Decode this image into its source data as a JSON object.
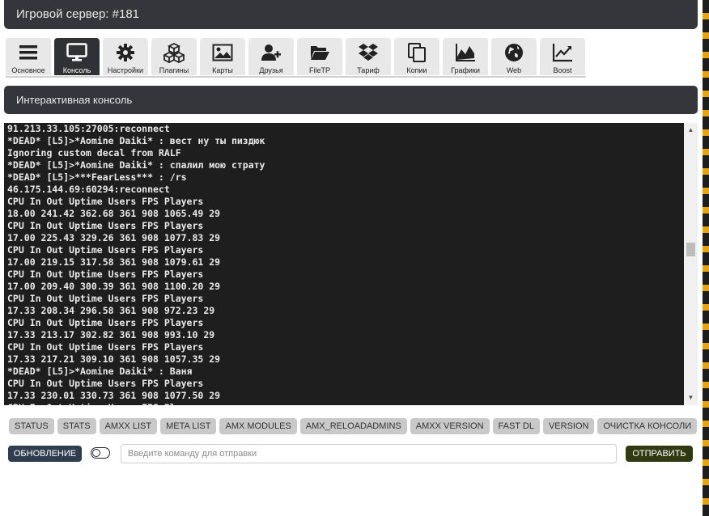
{
  "header": {
    "title": "Игровой сервер: #181"
  },
  "tabs": [
    {
      "label": "Основное",
      "icon": "menu-icon"
    },
    {
      "label": "Консоль",
      "icon": "monitor-icon",
      "active": true
    },
    {
      "label": "Настройки",
      "icon": "gear-icon"
    },
    {
      "label": "Плагины",
      "icon": "cubes-icon"
    },
    {
      "label": "Карты",
      "icon": "image-icon"
    },
    {
      "label": "Друзья",
      "icon": "add-user-icon"
    },
    {
      "label": "FileTP",
      "icon": "folder-open-icon"
    },
    {
      "label": "Тариф",
      "icon": "dropbox-icon"
    },
    {
      "label": "Копии",
      "icon": "copy-icon"
    },
    {
      "label": "Графики",
      "icon": "area-chart-icon"
    },
    {
      "label": "Web",
      "icon": "globe-icon"
    },
    {
      "label": "Boost",
      "icon": "line-chart-icon"
    }
  ],
  "console_section": {
    "title": "Интерактивная консоль"
  },
  "console": {
    "lines": [
      "91.213.33.105:27005:reconnect",
      "*DEAD* [L5]>*Aomine Daiki* : вест ну ты пиздюк",
      "Ignoring custom decal from RALF",
      "*DEAD* [L5]>*Aomine Daiki* : спалил мою страту",
      "*DEAD* [L5]>***FearLess*** : /rs",
      "46.175.144.69:60294:reconnect",
      "CPU In Out Uptime Users FPS Players",
      "18.00 241.42 362.68 361 908 1065.49 29",
      "CPU In Out Uptime Users FPS Players",
      "17.00 225.43 329.26 361 908 1077.83 29",
      "CPU In Out Uptime Users FPS Players",
      "17.00 219.15 317.58 361 908 1079.61 29",
      "CPU In Out Uptime Users FPS Players",
      "17.00 209.40 300.39 361 908 1100.20 29",
      "CPU In Out Uptime Users FPS Players",
      "17.33 208.34 296.58 361 908 972.23 29",
      "CPU In Out Uptime Users FPS Players",
      "17.33 213.17 302.82 361 908 993.10 29",
      "CPU In Out Uptime Users FPS Players",
      "17.33 217.21 309.10 361 908 1057.35 29",
      "*DEAD* [L5]>*Aomine Daiki* : Ваня",
      "CPU In Out Uptime Users FPS Players",
      "17.33 230.01 330.73 361 908 1077.50 29",
      "CPU In Out Uptime Users FPS Players"
    ]
  },
  "commands": [
    "STATUS",
    "STATS",
    "AMXX LIST",
    "META LIST",
    "AMX MODULES",
    "AMX_RELOADADMINS",
    "AMXX VERSION",
    "FAST DL",
    "VERSION",
    "ОЧИСТКА КОНСОЛИ"
  ],
  "controls": {
    "refresh_label": "ОБНОВЛЕНИЕ",
    "input_placeholder": "Введите команду для отправки",
    "input_value": "",
    "send_label": "ОТПРАВИТЬ"
  },
  "colors": {
    "header_bg": "#35363b",
    "active_tab_bg": "#2f3136",
    "console_bg": "#1e1e1e",
    "refresh_bg": "#2e3e4f",
    "send_bg": "#2f3a10"
  }
}
